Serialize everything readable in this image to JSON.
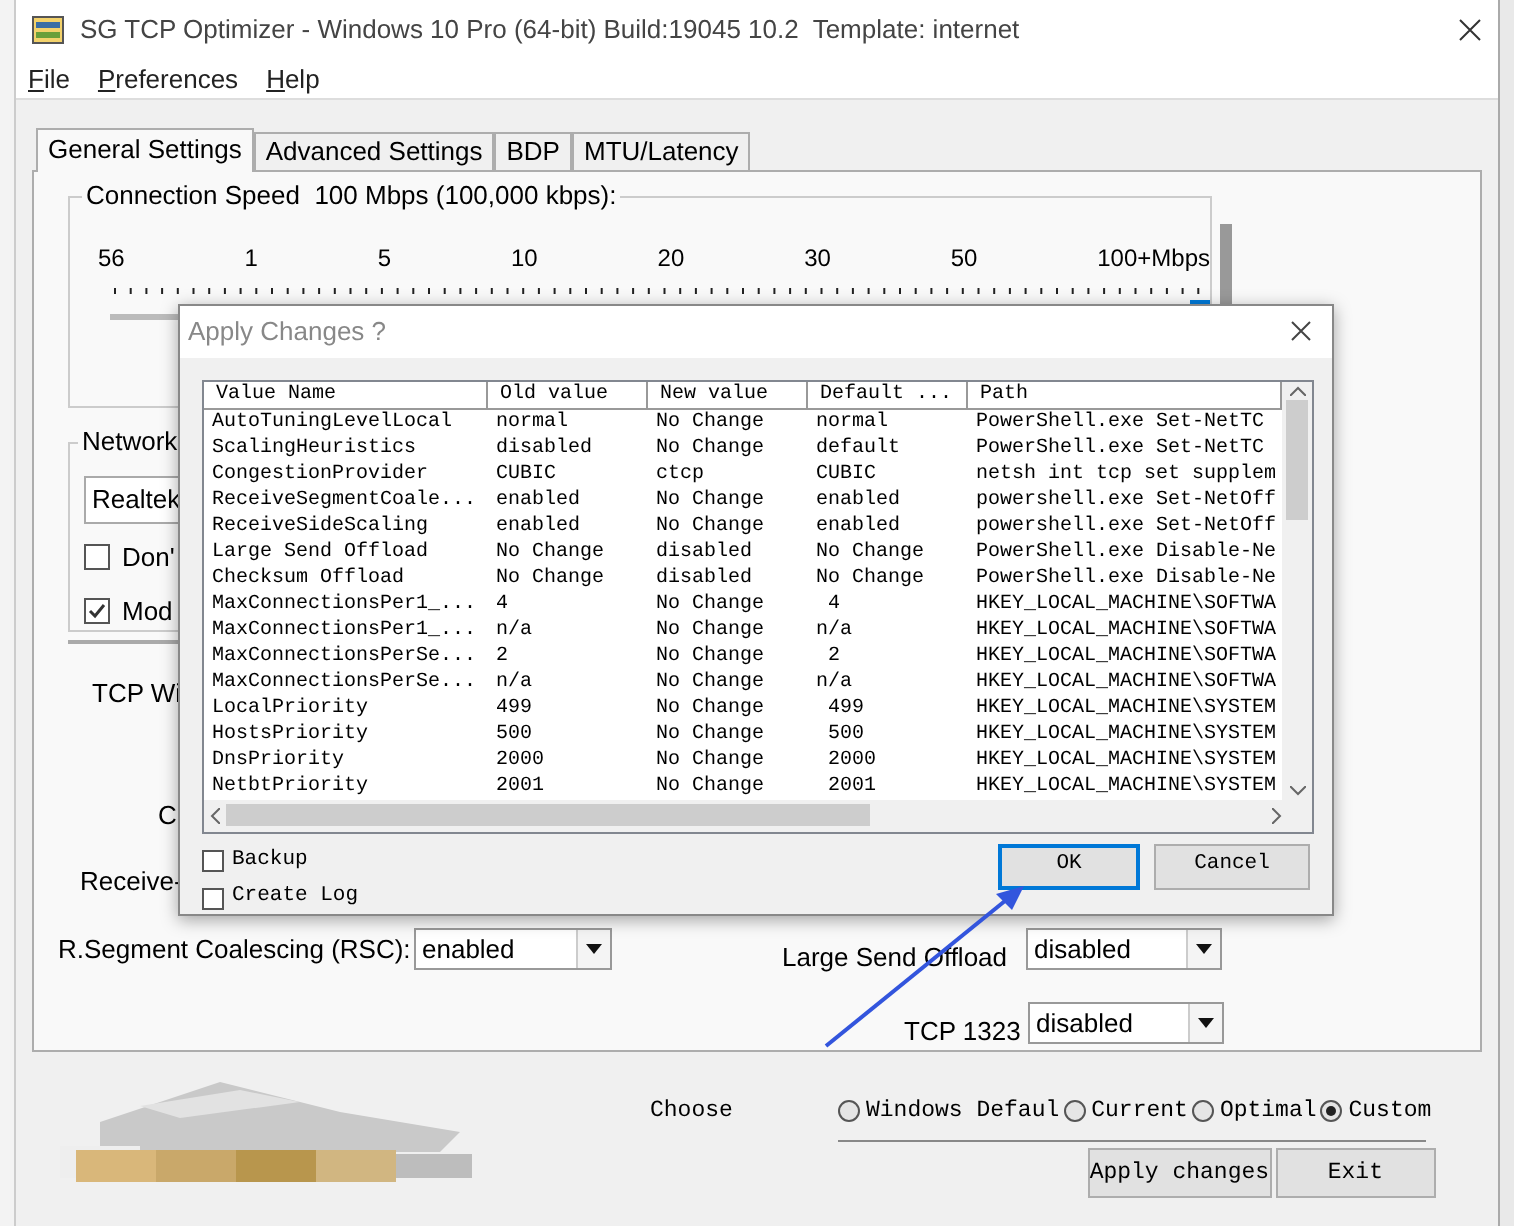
{
  "window": {
    "title": "SG TCP Optimizer - Windows 10 Pro (64-bit) Build:19045 10.2  Template: internet"
  },
  "menu": [
    "File",
    "Preferences",
    "Help"
  ],
  "tabs": [
    {
      "label": "General Settings",
      "selected": true
    },
    {
      "label": "Advanced Settings",
      "selected": false
    },
    {
      "label": "BDP",
      "selected": false
    },
    {
      "label": "MTU/Latency",
      "selected": false
    }
  ],
  "connection_speed": {
    "label": "Connection Speed  100 Mbps (100,000 kbps):",
    "scale": [
      "56",
      "1",
      "5",
      "10",
      "20",
      "30",
      "50",
      "100+Mbps"
    ],
    "level": 1
  },
  "network": {
    "label": "Network",
    "adapter": "Realtek",
    "options": [
      {
        "label": "Don'",
        "checked": false
      },
      {
        "label": "Mod",
        "checked": true
      }
    ]
  },
  "labels": {
    "tcp_window": "TCP Wi",
    "c": "C",
    "receive": "Receive-"
  },
  "rsc": {
    "label": "R.Segment Coalescing (RSC):",
    "value": "enabled"
  },
  "large_send_offload": {
    "label": "Large Send Offload",
    "value": "disabled"
  },
  "tcp_1323": {
    "label": "TCP 1323",
    "value": "disabled"
  },
  "choose": {
    "label": "Choose",
    "options": [
      {
        "label": "Windows Defaul",
        "selected": false
      },
      {
        "label": "Current",
        "selected": false
      },
      {
        "label": "Optimal",
        "selected": false
      },
      {
        "label": "Custom",
        "selected": true
      }
    ]
  },
  "buttons": [
    "Apply changes",
    "Exit"
  ],
  "dialog": {
    "title": "Apply Changes ?",
    "columns": [
      "Value Name",
      "Old value",
      "New value",
      "Default ...",
      "Path"
    ],
    "rows": [
      [
        "AutoTuningLevelLocal",
        "normal",
        "No Change",
        "normal",
        "PowerShell.exe Set-NetTC"
      ],
      [
        "ScalingHeuristics",
        "disabled",
        "No Change",
        "default",
        "PowerShell.exe Set-NetTC"
      ],
      [
        "CongestionProvider",
        "CUBIC",
        "ctcp",
        "CUBIC",
        "netsh int tcp set supplem"
      ],
      [
        "ReceiveSegmentCoale...",
        "enabled",
        "No Change",
        "enabled",
        "powershell.exe Set-NetOff"
      ],
      [
        "ReceiveSideScaling",
        "enabled",
        "No Change",
        "enabled",
        "powershell.exe Set-NetOff"
      ],
      [
        "Large Send Offload",
        "No Change",
        "disabled",
        "No Change",
        "PowerShell.exe Disable-Ne"
      ],
      [
        "Checksum Offload",
        "No Change",
        "disabled",
        "No Change",
        "PowerShell.exe Disable-Ne"
      ],
      [
        "MaxConnectionsPer1_...",
        "4",
        "No Change",
        " 4",
        "HKEY_LOCAL_MACHINE\\SOFTWA"
      ],
      [
        "MaxConnectionsPer1_...",
        "n/a",
        "No Change",
        "n/a",
        "HKEY_LOCAL_MACHINE\\SOFTWA"
      ],
      [
        "MaxConnectionsPerSe...",
        "2",
        "No Change",
        " 2",
        "HKEY_LOCAL_MACHINE\\SOFTWA"
      ],
      [
        "MaxConnectionsPerSe...",
        "n/a",
        "No Change",
        "n/a",
        "HKEY_LOCAL_MACHINE\\SOFTWA"
      ],
      [
        "LocalPriority",
        "499",
        "No Change",
        " 499",
        "HKEY_LOCAL_MACHINE\\SYSTEM"
      ],
      [
        "HostsPriority",
        "500",
        "No Change",
        " 500",
        "HKEY_LOCAL_MACHINE\\SYSTEM"
      ],
      [
        "DnsPriority",
        "2000",
        "No Change",
        " 2000",
        "HKEY_LOCAL_MACHINE\\SYSTEM"
      ],
      [
        "NetbtPriority",
        "2001",
        "No Change",
        " 2001",
        "HKEY_LOCAL_MACHINE\\SYSTEM"
      ]
    ],
    "options": [
      {
        "label": "Backup",
        "checked": false
      },
      {
        "label": "Create Log",
        "checked": false
      }
    ],
    "buttons": [
      "OK",
      "Cancel"
    ]
  }
}
